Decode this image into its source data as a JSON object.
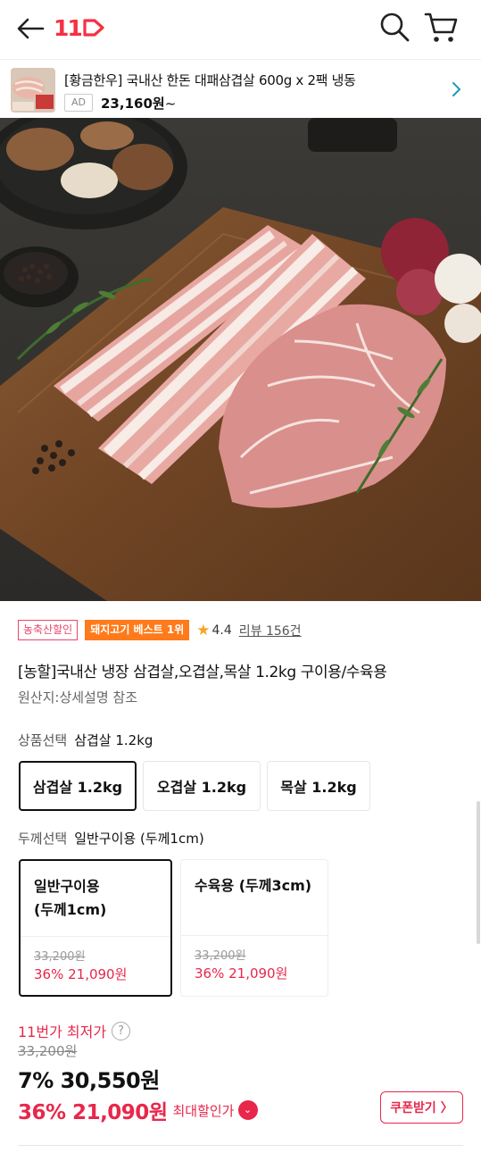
{
  "header": {
    "logo_text": "11",
    "back_icon": "arrow-left-icon",
    "search_icon": "search-icon",
    "cart_icon": "cart-icon",
    "brand_color": "#f43142"
  },
  "ad": {
    "title": "[황금한우] 국내산 한돈 대패삼겹살 600g x 2팩 냉동",
    "tag": "AD",
    "price": "23,160원",
    "price_suffix": "~"
  },
  "product": {
    "badge_category": "농축산할인",
    "badge_best": "돼지고기 베스트 1위",
    "rating": "4.4",
    "review_label": "리뷰 156건",
    "title": "[농할]국내산 냉장 삼겹살,오겹살,목살 1.2kg 구이용/수육용",
    "origin": "원산지:상세설명 참조"
  },
  "option1": {
    "label": "상품선택",
    "selected": "삼겹살 1.2kg",
    "items": [
      "삼겹살 1.2kg",
      "오겹살 1.2kg",
      "목살 1.2kg"
    ]
  },
  "option2": {
    "label": "두께선택",
    "selected": "일반구이용 (두께1cm)",
    "cards": [
      {
        "line1": "일반구이용",
        "line2": "(두께1cm)",
        "orig": "33,200원",
        "sale": "36% 21,090원"
      },
      {
        "line1": "수육용 (두께3cm)",
        "line2": "",
        "orig": "33,200원",
        "sale": "36% 21,090원"
      }
    ]
  },
  "price": {
    "lowest_label": "11번가 최저가",
    "help": "?",
    "original": "33,200원",
    "discounted": "7% 30,550원",
    "max_price": "36% 21,090원",
    "max_label": "최대할인가",
    "coupon": "쿠폰받기 〉",
    "accent_color": "#e8274b"
  }
}
